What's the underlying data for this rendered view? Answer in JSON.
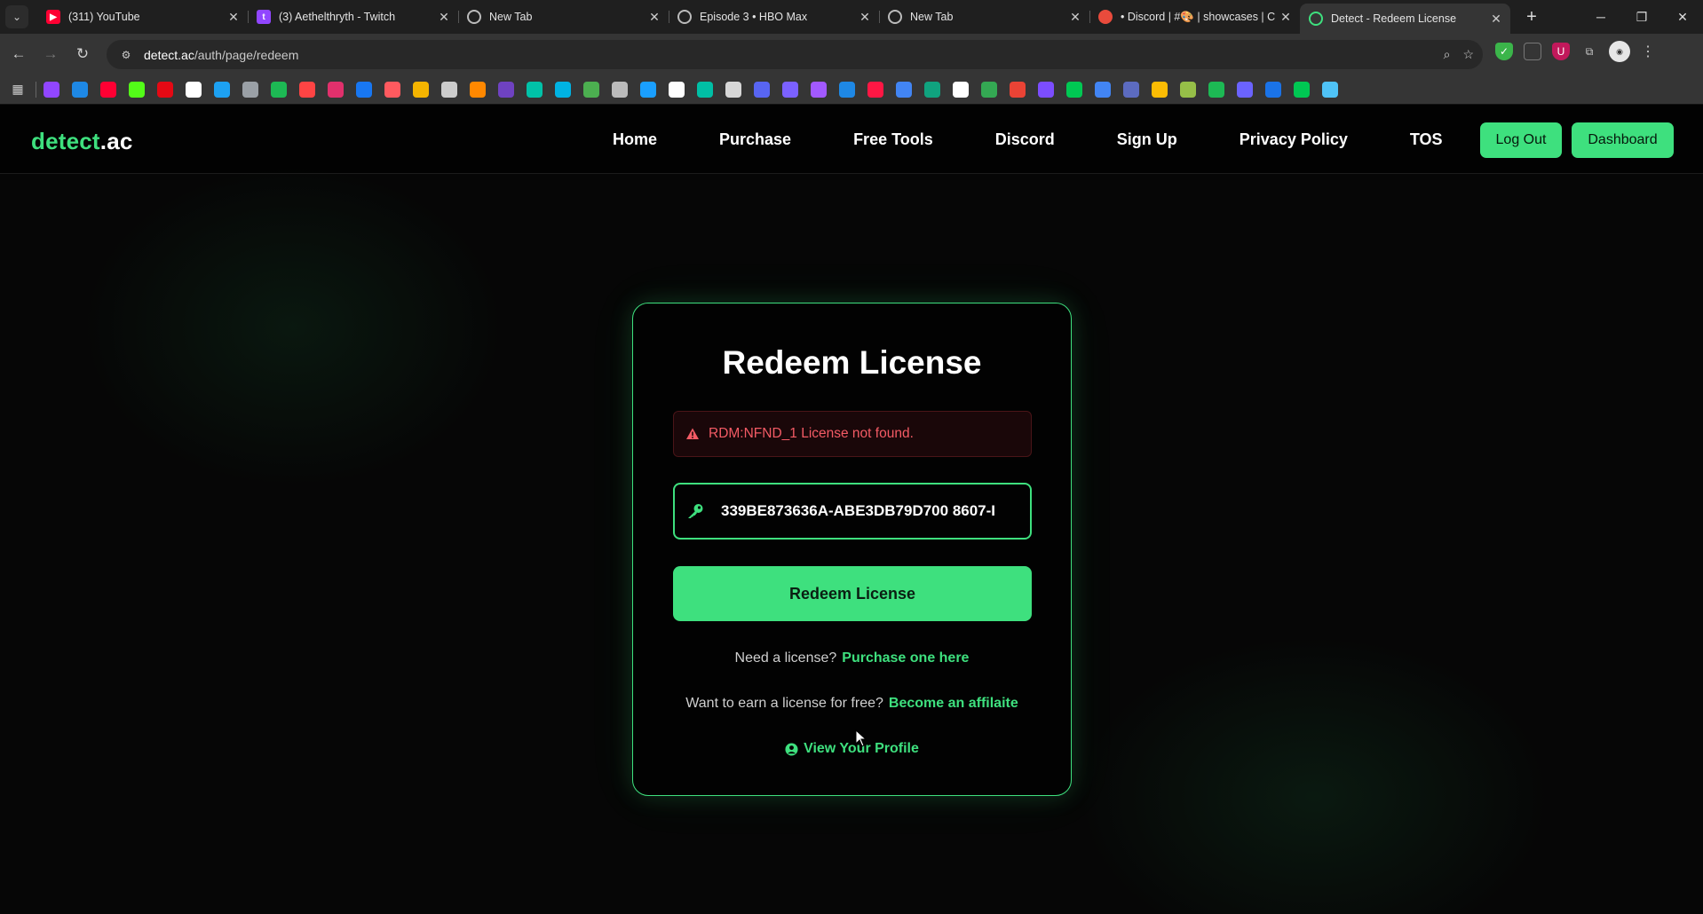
{
  "browser": {
    "tabs": [
      {
        "title": "(311) YouTube",
        "favicon": "youtube-icon",
        "color": "#ff0033",
        "active": false
      },
      {
        "title": "(3) Aethelthryth - Twitch",
        "favicon": "twitch-icon",
        "color": "#9146ff",
        "active": false
      },
      {
        "title": "New Tab",
        "favicon": "chrome-icon",
        "color": "#9aa0a6",
        "active": false
      },
      {
        "title": "Episode 3 • HBO Max",
        "favicon": "globe-icon",
        "color": "#9aa0a6",
        "active": false
      },
      {
        "title": "New Tab",
        "favicon": "chrome-icon",
        "color": "#9aa0a6",
        "active": false
      },
      {
        "title": "• Discord | #🎨 | showcases | C",
        "favicon": "discord-icon",
        "color": "#e94b3c",
        "active": false
      },
      {
        "title": "Detect - Redeem License",
        "favicon": "detect-icon",
        "color": "#3ee07e",
        "active": true
      }
    ],
    "url_host": "detect.ac",
    "url_path": "/auth/page/redeem",
    "bookmark_colors": [
      "#9146ff",
      "#1e88e5",
      "#ff0033",
      "#53fc18",
      "#e50914",
      "#ffffff",
      "#1da1f2",
      "#9aa0a6",
      "#1db954",
      "#ff4444",
      "#e1306c",
      "#1877f2",
      "#ff5a5f",
      "#f4b400",
      "#cccccc",
      "#ff8800",
      "#6f42c1",
      "#00c2a8",
      "#00b3e3",
      "#4caf50",
      "#bbbbbb",
      "#1a9fff",
      "#ffffff",
      "#00bfa5",
      "#d7d7d7",
      "#5865f2",
      "#7b61ff",
      "#a259ff",
      "#1e88e5",
      "#ff1744",
      "#4285f4",
      "#10a37f",
      "#ffffff",
      "#34a853",
      "#ea4335",
      "#7c4dff",
      "#00c853",
      "#4285f4",
      "#5c6bc0",
      "#fbbc04",
      "#96bf48",
      "#1db954",
      "#6b63ff",
      "#1a73e8",
      "#00c853",
      "#4fc3f7"
    ]
  },
  "site": {
    "logo_main": "detect",
    "logo_suffix": ".ac",
    "nav": [
      "Home",
      "Purchase",
      "Free Tools",
      "Discord",
      "Sign Up",
      "Privacy Policy",
      "TOS"
    ],
    "logout_label": "Log Out",
    "dashboard_label": "Dashboard",
    "accent": "#3ee07e"
  },
  "card": {
    "title": "Redeem License",
    "error": "RDM:NFND_1 License not found.",
    "license_value": "339BE873636A-ABE3DB79D700 8607-I",
    "redeem_label": "Redeem License",
    "need_license_text": "Need a license?",
    "purchase_link": "Purchase one here",
    "earn_text": "Want to earn a license for free?",
    "affiliate_link": "Become an affilaite",
    "profile_link": "View Your Profile"
  }
}
